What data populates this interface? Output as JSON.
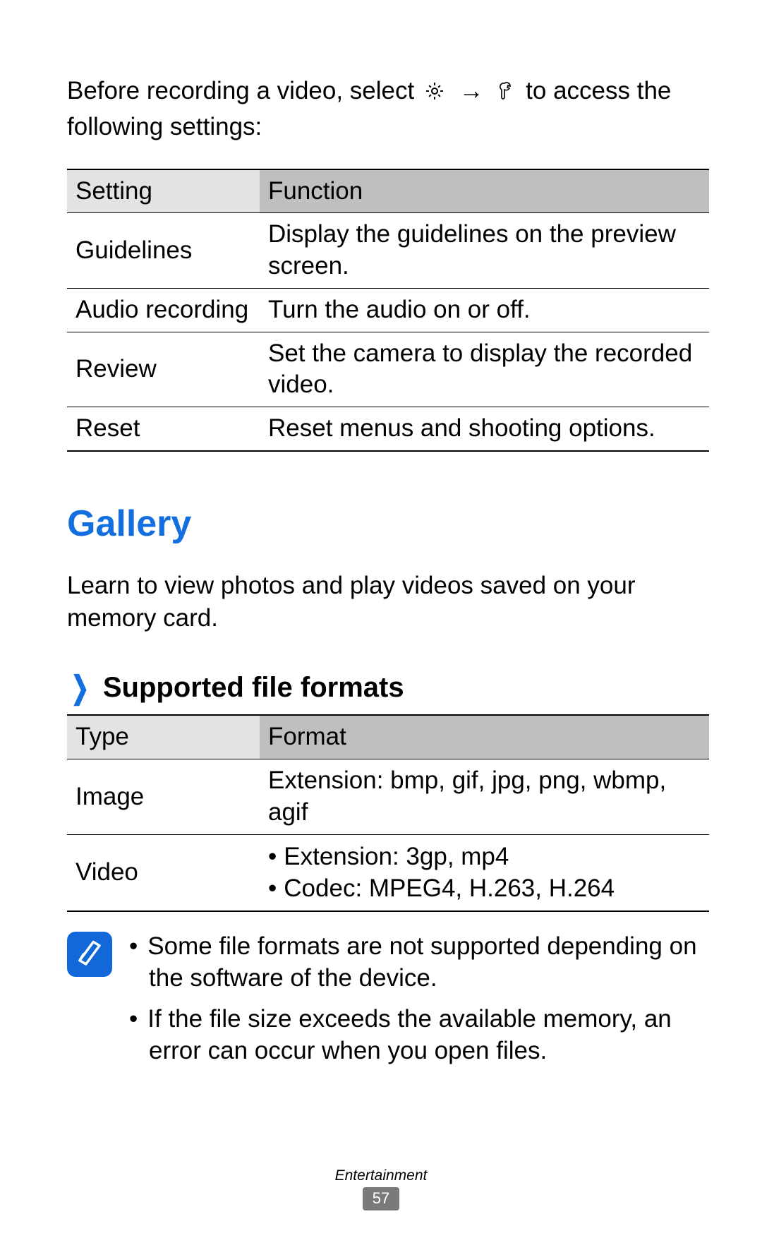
{
  "intro": {
    "part1": "Before recording a video, select ",
    "arrow": "→",
    "part2": " to access the following settings:"
  },
  "settings_table": {
    "head_col1": "Setting",
    "head_col2": "Function",
    "rows": [
      {
        "setting": "Guidelines",
        "function": "Display the guidelines on the preview screen."
      },
      {
        "setting": "Audio recording",
        "function": "Turn the audio on or off."
      },
      {
        "setting": "Review",
        "function": "Set the camera to display the recorded video."
      },
      {
        "setting": "Reset",
        "function": "Reset menus and shooting options."
      }
    ]
  },
  "gallery": {
    "title": "Gallery",
    "description": "Learn to view photos and play videos saved on your memory card."
  },
  "supported": {
    "heading": "Supported file formats"
  },
  "formats_table": {
    "head_col1": "Type",
    "head_col2": "Format",
    "rows": [
      {
        "type": "Image",
        "format_text": "Extension: bmp, gif, jpg, png, wbmp, agif"
      },
      {
        "type": "Video",
        "bullets": [
          "Extension: 3gp, mp4",
          "Codec: MPEG4, H.263, H.264"
        ]
      }
    ]
  },
  "notes": {
    "items": [
      "Some file formats are not supported depending on the software of the device.",
      "If the file size exceeds the available memory, an error can occur when you open files."
    ]
  },
  "footer": {
    "section": "Entertainment",
    "page": "57"
  }
}
